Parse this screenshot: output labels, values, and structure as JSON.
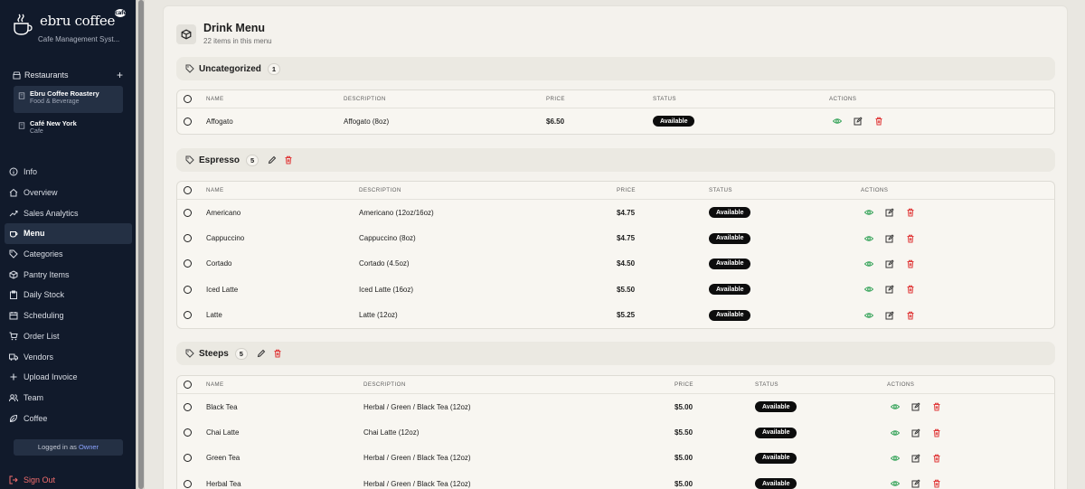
{
  "brand": {
    "name": "ebru coffee",
    "badge": "cafe",
    "subtitle": "Cafe Management Syst..."
  },
  "restaurants": {
    "label": "Restaurants",
    "add": "+",
    "items": [
      {
        "name": "Ebru Coffee Roastery",
        "type": "Food & Beverage",
        "active": true
      },
      {
        "name": "Café New York",
        "type": "Cafe",
        "active": false
      }
    ]
  },
  "nav": [
    {
      "label": "Info",
      "icon": "info-icon"
    },
    {
      "label": "Overview",
      "icon": "home-icon"
    },
    {
      "label": "Sales Analytics",
      "icon": "trend-icon"
    },
    {
      "label": "Menu",
      "icon": "coffee-cup-icon",
      "active": true
    },
    {
      "label": "Categories",
      "icon": "tag-icon"
    },
    {
      "label": "Pantry Items",
      "icon": "box-icon"
    },
    {
      "label": "Daily Stock",
      "icon": "clipboard-icon"
    },
    {
      "label": "Scheduling",
      "icon": "calendar-icon"
    },
    {
      "label": "Order List",
      "icon": "cart-icon"
    },
    {
      "label": "Vendors",
      "icon": "truck-icon"
    },
    {
      "label": "Upload Invoice",
      "icon": "plus-icon"
    },
    {
      "label": "Team",
      "icon": "users-icon"
    },
    {
      "label": "Coffee",
      "icon": "leaf-icon"
    }
  ],
  "session": {
    "prefix": "Logged in as",
    "role": "Owner"
  },
  "signout": "Sign Out",
  "header": {
    "title": "Drink Menu",
    "subtitle": "22 items in this menu"
  },
  "columns": {
    "name": "NAME",
    "description": "DESCRIPTION",
    "price": "PRICE",
    "status": "STATUS",
    "actions": "ACTIONS"
  },
  "categories": [
    {
      "name": "Uncategorized",
      "count": "1",
      "editable": false,
      "items": [
        {
          "name": "Affogato",
          "description": "Affogato (8oz)",
          "price": "$6.50",
          "status": "Available"
        }
      ]
    },
    {
      "name": "Espresso",
      "count": "5",
      "editable": true,
      "items": [
        {
          "name": "Americano",
          "description": "Americano (12oz/16oz)",
          "price": "$4.75",
          "status": "Available"
        },
        {
          "name": "Cappuccino",
          "description": "Cappuccino (8oz)",
          "price": "$4.75",
          "status": "Available"
        },
        {
          "name": "Cortado",
          "description": "Cortado (4.5oz)",
          "price": "$4.50",
          "status": "Available"
        },
        {
          "name": "Iced Latte",
          "description": "Iced Latte (16oz)",
          "price": "$5.50",
          "status": "Available"
        },
        {
          "name": "Latte",
          "description": "Latte (12oz)",
          "price": "$5.25",
          "status": "Available"
        }
      ]
    },
    {
      "name": "Steeps",
      "count": "5",
      "editable": true,
      "items": [
        {
          "name": "Black Tea",
          "description": "Herbal / Green / Black Tea (12oz)",
          "price": "$5.00",
          "status": "Available"
        },
        {
          "name": "Chai Latte",
          "description": "Chai Latte (12oz)",
          "price": "$5.50",
          "status": "Available"
        },
        {
          "name": "Green Tea",
          "description": "Herbal / Green / Black Tea (12oz)",
          "price": "$5.00",
          "status": "Available"
        },
        {
          "name": "Herbal Tea",
          "description": "Herbal / Green / Black Tea (12oz)",
          "price": "$5.00",
          "status": "Available"
        }
      ]
    }
  ],
  "colors": {
    "sidebar": "#111a2b",
    "active": "#243044",
    "view": "#3aa55d",
    "delete": "#e03b3b",
    "signout": "#f26d6d"
  }
}
